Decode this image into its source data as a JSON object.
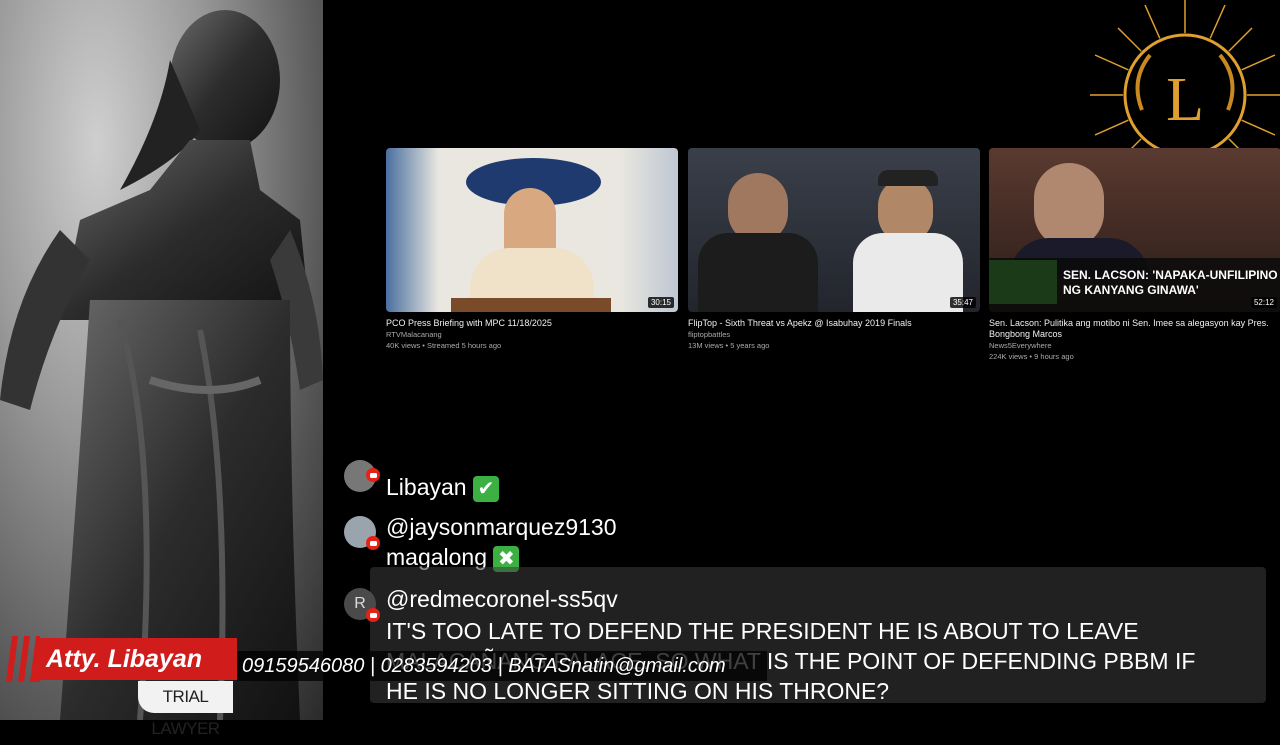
{
  "videos": [
    {
      "title": "PCO Press Briefing with MPC 11/18/2025",
      "channel": "RTVMalacanang",
      "meta": "40K views • Streamed 5 hours ago",
      "duration": "30:15"
    },
    {
      "title": "FlipTop - Sixth Threat vs Apekz @ Isabuhay 2019 Finals",
      "channel": "fliptopbattles",
      "meta": "13M views • 5 years ago",
      "duration": "35:47"
    },
    {
      "title": "Sen. Lacson: Pulitika ang motibo ni Sen. Imee sa alegasyon kay Pres. Bongbong Marcos",
      "channel": "News5Everywhere",
      "meta": "224K views • 9 hours ago",
      "duration": "52:12",
      "thumb_caption_line1": "SEN. LACSON: 'NAPAKA-UNFILIPINO",
      "thumb_caption_line2": "NG KANYANG GINAWA'"
    }
  ],
  "chat": [
    {
      "username": "",
      "text": "Libayan",
      "mark": "✔"
    },
    {
      "username": "@jaysonmarquez9130",
      "text": "magalong",
      "mark": "✖"
    },
    {
      "username": "@redmecoronel-ss5qv",
      "avatar_letter": "R",
      "text_lines": [
        "IT'S TOO LATE TO DEFEND THE PRESIDENT HE IS ABOUT TO LEAVE",
        "MALACAÑANG PALACE. SO WHAT IS THE POINT OF DEFENDING PBBM IF",
        "HE IS NO LONGER SITTING ON HIS THRONE?"
      ]
    }
  ],
  "overlay": {
    "name": "Atty. Libayan",
    "title": "TRIAL LAWYER",
    "contact": "09159546080 | 0283594203 | BATASnatin@gmail.com"
  },
  "logo_letter": "L",
  "colors": {
    "accent_red": "#d11c1c",
    "logo_gold": "#e0a030",
    "check_green": "#3cb043"
  }
}
